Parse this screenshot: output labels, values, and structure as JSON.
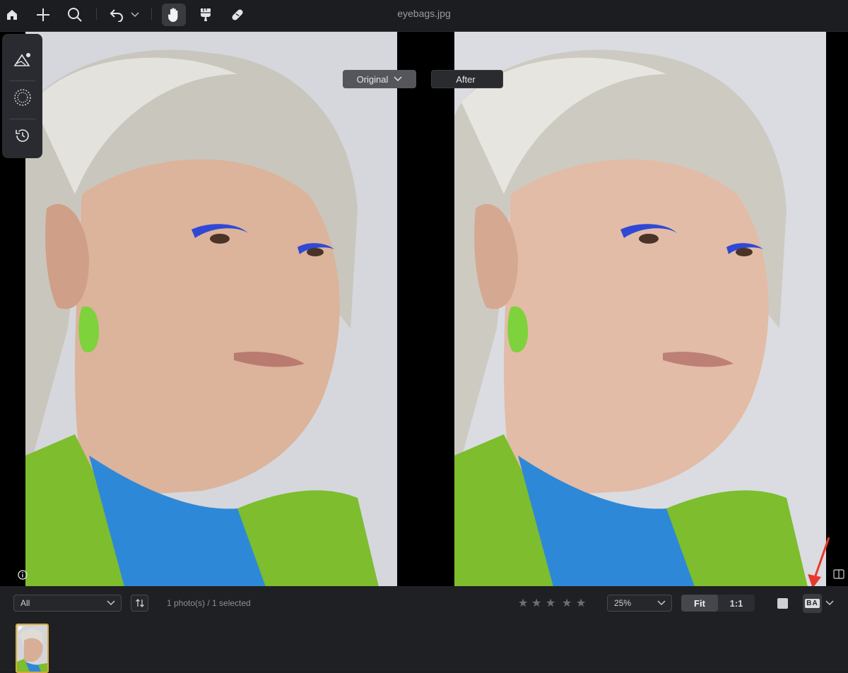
{
  "window": {
    "title": "eyebags.jpg"
  },
  "toolbar": {
    "icons": [
      "home-icon",
      "plus-icon",
      "search-icon",
      "undo-icon",
      "chevron-down-icon",
      "hand-icon",
      "brush-icon",
      "bandage-icon"
    ]
  },
  "left_tools": {
    "icons": [
      "adjust-icon",
      "mask-icon",
      "history-icon"
    ]
  },
  "compare": {
    "original_label": "Original",
    "after_label": "After"
  },
  "filter": {
    "selected": "All"
  },
  "status": {
    "text": "1 photo(s) / 1 selected"
  },
  "rating": {
    "stars": 5,
    "value": 0
  },
  "zoom": {
    "selected": "25%"
  },
  "zoom_mode": {
    "fit_label": "Fit",
    "one_to_one_label": "1:1",
    "active": "Fit"
  },
  "view_mode": {
    "ba_label": "BA"
  },
  "colors": {
    "accent_thumb_border": "#d9a93a",
    "annotation_arrow": "#e83a2a",
    "background": "#1c1d20"
  }
}
